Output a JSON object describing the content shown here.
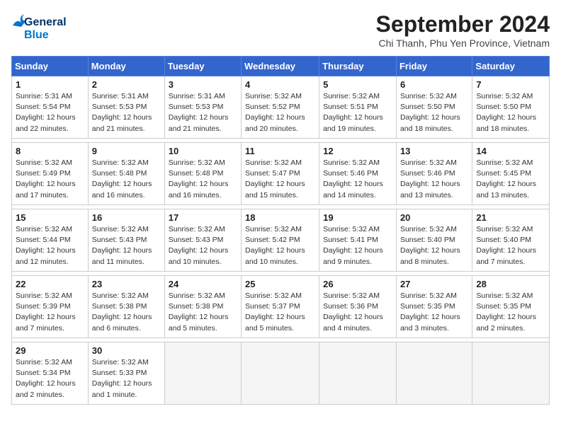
{
  "header": {
    "logo_general": "General",
    "logo_blue": "Blue",
    "title": "September 2024",
    "subtitle": "Chi Thanh, Phu Yen Province, Vietnam"
  },
  "days_of_week": [
    "Sunday",
    "Monday",
    "Tuesday",
    "Wednesday",
    "Thursday",
    "Friday",
    "Saturday"
  ],
  "weeks": [
    [
      {
        "num": "1",
        "sunrise": "5:31 AM",
        "sunset": "5:54 PM",
        "daylight": "12 hours and 22 minutes."
      },
      {
        "num": "2",
        "sunrise": "5:31 AM",
        "sunset": "5:53 PM",
        "daylight": "12 hours and 21 minutes."
      },
      {
        "num": "3",
        "sunrise": "5:31 AM",
        "sunset": "5:53 PM",
        "daylight": "12 hours and 21 minutes."
      },
      {
        "num": "4",
        "sunrise": "5:32 AM",
        "sunset": "5:52 PM",
        "daylight": "12 hours and 20 minutes."
      },
      {
        "num": "5",
        "sunrise": "5:32 AM",
        "sunset": "5:51 PM",
        "daylight": "12 hours and 19 minutes."
      },
      {
        "num": "6",
        "sunrise": "5:32 AM",
        "sunset": "5:50 PM",
        "daylight": "12 hours and 18 minutes."
      },
      {
        "num": "7",
        "sunrise": "5:32 AM",
        "sunset": "5:50 PM",
        "daylight": "12 hours and 18 minutes."
      }
    ],
    [
      {
        "num": "8",
        "sunrise": "5:32 AM",
        "sunset": "5:49 PM",
        "daylight": "12 hours and 17 minutes."
      },
      {
        "num": "9",
        "sunrise": "5:32 AM",
        "sunset": "5:48 PM",
        "daylight": "12 hours and 16 minutes."
      },
      {
        "num": "10",
        "sunrise": "5:32 AM",
        "sunset": "5:48 PM",
        "daylight": "12 hours and 16 minutes."
      },
      {
        "num": "11",
        "sunrise": "5:32 AM",
        "sunset": "5:47 PM",
        "daylight": "12 hours and 15 minutes."
      },
      {
        "num": "12",
        "sunrise": "5:32 AM",
        "sunset": "5:46 PM",
        "daylight": "12 hours and 14 minutes."
      },
      {
        "num": "13",
        "sunrise": "5:32 AM",
        "sunset": "5:46 PM",
        "daylight": "12 hours and 13 minutes."
      },
      {
        "num": "14",
        "sunrise": "5:32 AM",
        "sunset": "5:45 PM",
        "daylight": "12 hours and 13 minutes."
      }
    ],
    [
      {
        "num": "15",
        "sunrise": "5:32 AM",
        "sunset": "5:44 PM",
        "daylight": "12 hours and 12 minutes."
      },
      {
        "num": "16",
        "sunrise": "5:32 AM",
        "sunset": "5:43 PM",
        "daylight": "12 hours and 11 minutes."
      },
      {
        "num": "17",
        "sunrise": "5:32 AM",
        "sunset": "5:43 PM",
        "daylight": "12 hours and 10 minutes."
      },
      {
        "num": "18",
        "sunrise": "5:32 AM",
        "sunset": "5:42 PM",
        "daylight": "12 hours and 10 minutes."
      },
      {
        "num": "19",
        "sunrise": "5:32 AM",
        "sunset": "5:41 PM",
        "daylight": "12 hours and 9 minutes."
      },
      {
        "num": "20",
        "sunrise": "5:32 AM",
        "sunset": "5:40 PM",
        "daylight": "12 hours and 8 minutes."
      },
      {
        "num": "21",
        "sunrise": "5:32 AM",
        "sunset": "5:40 PM",
        "daylight": "12 hours and 7 minutes."
      }
    ],
    [
      {
        "num": "22",
        "sunrise": "5:32 AM",
        "sunset": "5:39 PM",
        "daylight": "12 hours and 7 minutes."
      },
      {
        "num": "23",
        "sunrise": "5:32 AM",
        "sunset": "5:38 PM",
        "daylight": "12 hours and 6 minutes."
      },
      {
        "num": "24",
        "sunrise": "5:32 AM",
        "sunset": "5:38 PM",
        "daylight": "12 hours and 5 minutes."
      },
      {
        "num": "25",
        "sunrise": "5:32 AM",
        "sunset": "5:37 PM",
        "daylight": "12 hours and 5 minutes."
      },
      {
        "num": "26",
        "sunrise": "5:32 AM",
        "sunset": "5:36 PM",
        "daylight": "12 hours and 4 minutes."
      },
      {
        "num": "27",
        "sunrise": "5:32 AM",
        "sunset": "5:35 PM",
        "daylight": "12 hours and 3 minutes."
      },
      {
        "num": "28",
        "sunrise": "5:32 AM",
        "sunset": "5:35 PM",
        "daylight": "12 hours and 2 minutes."
      }
    ],
    [
      {
        "num": "29",
        "sunrise": "5:32 AM",
        "sunset": "5:34 PM",
        "daylight": "12 hours and 2 minutes."
      },
      {
        "num": "30",
        "sunrise": "5:32 AM",
        "sunset": "5:33 PM",
        "daylight": "12 hours and 1 minute."
      },
      null,
      null,
      null,
      null,
      null
    ]
  ]
}
